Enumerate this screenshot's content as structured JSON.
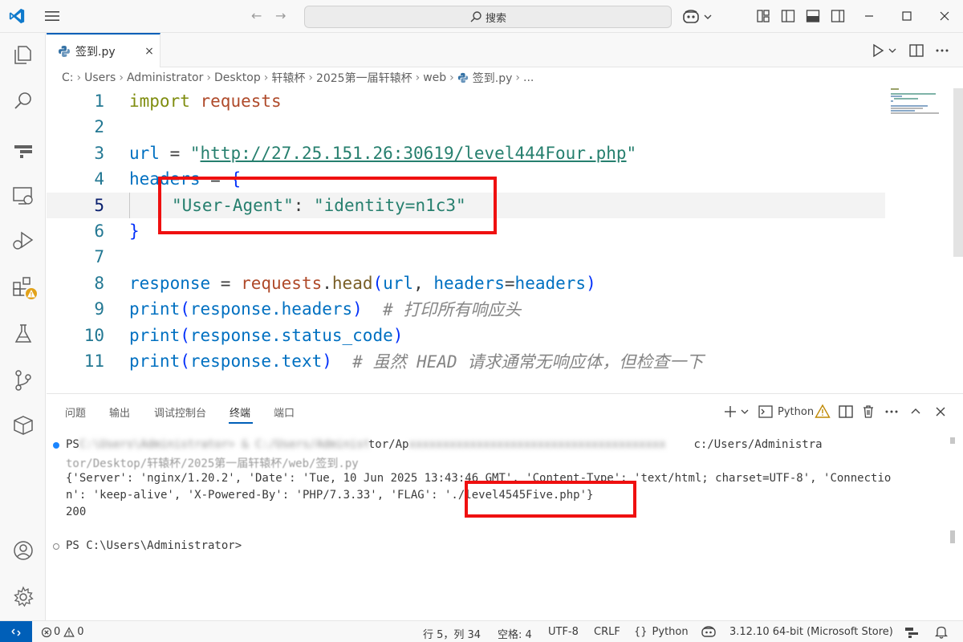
{
  "titlebar": {
    "search_label": "搜索"
  },
  "tab": {
    "label": "签到.py",
    "close": "×"
  },
  "breadcrumb": [
    "C:",
    "Users",
    "Administrator",
    "Desktop",
    "轩辕杯",
    "2025第一届轩辕杯",
    "web",
    "签到.py",
    "..."
  ],
  "editor": {
    "line_numbers": [
      "1",
      "2",
      "3",
      "4",
      "5",
      "6",
      "7",
      "8",
      "9",
      "10",
      "11"
    ],
    "current_line": 5,
    "code": {
      "l1_kw": "import",
      "l1_mod": "requests",
      "l3_var": "url",
      "l3_op": " = ",
      "l3_q1": "\"",
      "l3_url": "http://27.25.151.26:30619/level444Four.php",
      "l3_q2": "\"",
      "l4_var": "headers",
      "l4_op": " = ",
      "l4_brace": "{",
      "l5_key": "\"User-Agent\"",
      "l5_colon": ": ",
      "l5_val": "\"identity=n1c3\"",
      "l6_brace": "}",
      "l8_var": "response",
      "l8_op": " = ",
      "l8_mod": "requests",
      "l8_dot": ".",
      "l8_fn": "head",
      "l8_args_open": "(",
      "l8_arg1": "url",
      "l8_comma": ", ",
      "l8_kw": "headers",
      "l8_eq": "=",
      "l8_arg2": "headers",
      "l8_args_close": ")",
      "l9_fn": "print",
      "l9_open": "(",
      "l9_arg": "response.headers",
      "l9_close": ")",
      "l9_comment": "  # 打印所有响应头",
      "l10_fn": "print",
      "l10_open": "(",
      "l10_arg": "response.status_code",
      "l10_close": ")",
      "l11_fn": "print",
      "l11_open": "(",
      "l11_arg": "response.text",
      "l11_close": ")",
      "l11_comment": "  # 虽然 HEAD 请求通常无响应体，但检查一下"
    }
  },
  "panel": {
    "tabs": [
      "问题",
      "输出",
      "调试控制台",
      "终端",
      "端口"
    ],
    "active_tab": "终端",
    "python_label": "Python",
    "terminal": {
      "cmd_prefix": "PS",
      "cmd_blurred_1": "C:\\Users\\Administrator> & C:/Users/Administrator/AppData/Local/Microsoft/WindowsApps/python3.11.exe",
      "cmd_visible_mid": "tor/Ap",
      "cmd_visible_end": "c:/Users/Administra",
      "cmd_line2": "tor/Desktop/轩辕杯/2025第一届轩辕杯/web/签到.py",
      "out_line1": "{'Server': 'nginx/1.20.2', 'Date': 'Tue, 10 Jun 2025 13:43:46 GMT', 'Content-Type': 'text/html; charset=UTF-8', 'Connectio",
      "out_line2": "n': 'keep-alive', 'X-Powered-By': 'PHP/7.3.33', 'FLAG': './level4545Five.php'}",
      "out_line3": "200",
      "prompt": "PS C:\\Users\\Administrator>"
    }
  },
  "statusbar": {
    "errors": "0",
    "warnings": "0",
    "position": "行 5，列 34",
    "spaces": "空格: 4",
    "encoding": "UTF-8",
    "eol": "CRLF",
    "language": "Python",
    "interpreter": "3.12.10 64-bit (Microsoft Store)"
  },
  "colors": {
    "accent": "#005fb8",
    "highlight_box": "#ef1010",
    "warning": "#e2a21a"
  }
}
